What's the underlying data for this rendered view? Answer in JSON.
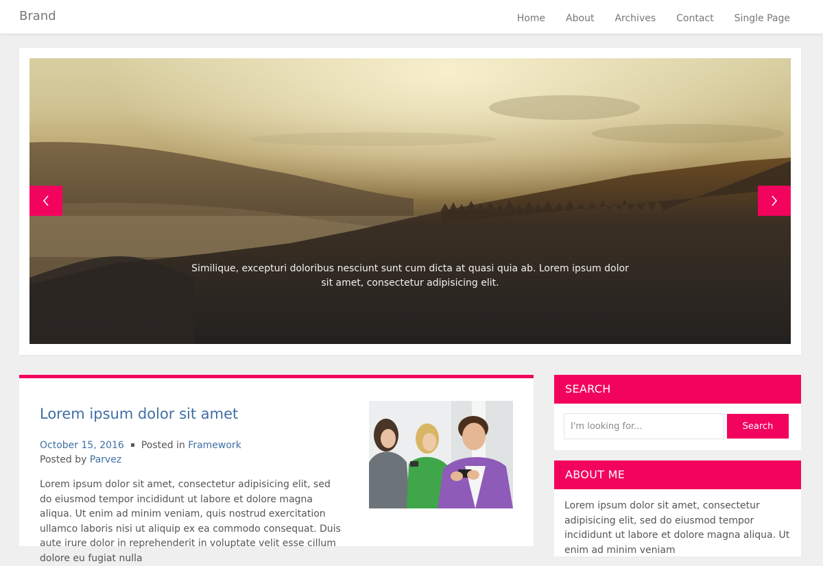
{
  "navbar": {
    "brand": "Brand",
    "items": [
      {
        "label": "Home"
      },
      {
        "label": "About"
      },
      {
        "label": "Archives"
      },
      {
        "label": "Contact"
      },
      {
        "label": "Single Page"
      }
    ]
  },
  "slider": {
    "caption": "Similique, excepturi doloribus nesciunt sunt cum dicta at quasi quia ab. Lorem ipsum dolor sit amet, consectetur adipisicing elit.",
    "prev_icon": "chevron-left-icon",
    "next_icon": "chevron-right-icon"
  },
  "post": {
    "title": "Lorem ipsum dolor sit amet",
    "date": "October 15, 2016",
    "posted_in_label": "Posted in",
    "category": "Framework",
    "posted_by_label": "Posted by",
    "author": "Parvez",
    "excerpt": "Lorem ipsum dolor sit amet, consectetur adipisicing elit, sed do eiusmod tempor incididunt ut labore et dolore magna aliqua. Ut enim ad minim veniam, quis nostrud exercitation ullamco laboris nisi ut aliquip ex ea commodo consequat. Duis aute irure dolor in reprehenderit in voluptate velit esse cillum dolore eu fugiat nulla"
  },
  "sidebar": {
    "search": {
      "title": "SEARCH",
      "placeholder": "I'm looking for...",
      "value": "",
      "button_label": "Search"
    },
    "about": {
      "title": "ABOUT ME",
      "text": "Lorem ipsum dolor sit amet, consectetur adipisicing elit, sed do eiusmod tempor incididunt ut labore et dolore magna aliqua. Ut enim ad minim veniam"
    }
  },
  "colors": {
    "accent": "#f2035e",
    "link": "#3f6ea5",
    "background": "#efefef"
  }
}
